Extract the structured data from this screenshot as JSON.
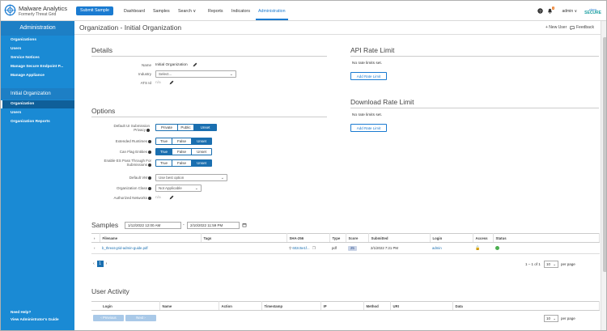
{
  "brand": {
    "title": "Malware Analytics",
    "subtitle": "Formerly Threat Grid"
  },
  "topnav": {
    "submit": "Submit Sample",
    "items": [
      "Dashboard",
      "Samples",
      "Search ∨",
      "Reports",
      "Indicators",
      "Administration"
    ],
    "user": "admin ∨",
    "cisco": "cisco",
    "secure": "SECURE",
    "notif_count": "1"
  },
  "sidebar": {
    "header": "Administration",
    "items": [
      "Organizations",
      "Users",
      "Service Notices",
      "Manage Secure Endpoint P...",
      "Manage Appliance"
    ],
    "org_header": "Initial Organization",
    "org_items": [
      "Organization",
      "Users",
      "Organization Reports"
    ],
    "help": "Need Help?",
    "guide": "View Administrator's Guide"
  },
  "page": {
    "title": "Organization - Initial Organization",
    "new_user": "+ New User",
    "feedback": "Feedback"
  },
  "details": {
    "title": "Details",
    "name_label": "Name",
    "name_value": "Initial Organization",
    "industry_label": "Industry",
    "industry_placeholder": "Select...",
    "ats_label": "ATS Id",
    "ats_value": "n/a"
  },
  "options": {
    "title": "Options",
    "rows": [
      {
        "label": "Default UI Submission Privacy",
        "choices": [
          "Private",
          "Public",
          "Unset"
        ],
        "selected": 2
      },
      {
        "label": "Extended Runtimes",
        "choices": [
          "True",
          "False",
          "Unset"
        ],
        "selected": 2
      },
      {
        "label": "Can Flag Entities",
        "choices": [
          "True",
          "False",
          "Unset"
        ],
        "selected": 0
      },
      {
        "label": "Enable ES Pass Through For Submissions",
        "choices": [
          "True",
          "False",
          "Unset"
        ],
        "selected": 2
      }
    ],
    "vm_label": "Default VM",
    "vm_value": "Use best option",
    "class_label": "Organization Class",
    "class_value": "Not Applicable",
    "networks_label": "Authorized Networks",
    "networks_value": "n/a"
  },
  "api_rate": {
    "title": "API Rate Limit",
    "text": "No rate limits set.",
    "button": "Add Rate Limit"
  },
  "download_rate": {
    "title": "Download Rate Limit",
    "text": "No rate limits set.",
    "button": "Add Rate Limit"
  },
  "samples": {
    "title": "Samples",
    "date_from": "1/12/2022 12:00 AM",
    "date_to": "2/10/2022 11:59 PM",
    "columns": [
      "Filename",
      "Tags",
      "SHA-256",
      "Type",
      "Score",
      "Submitted",
      "Login",
      "Access",
      "Status"
    ],
    "rows": [
      {
        "filename": "b_threat-grid-admin-guide.pdf",
        "tags": "",
        "sha": "602c5e1f...",
        "type": "pdf",
        "score": "25",
        "submitted": "2/1/2022 7:21 PM",
        "login": "admin"
      }
    ],
    "page": "1",
    "range": "1 – 1 of 1",
    "per_page_value": "10",
    "per_page_label": "per page"
  },
  "activity": {
    "title": "User Activity",
    "columns": [
      "Login",
      "Name",
      "Action",
      "Timestamp",
      "IP",
      "Method",
      "URI",
      "Data"
    ],
    "prev": "‹ Previous",
    "next": "Next ›",
    "per_page_value": "10",
    "per_page_label": "per page"
  }
}
